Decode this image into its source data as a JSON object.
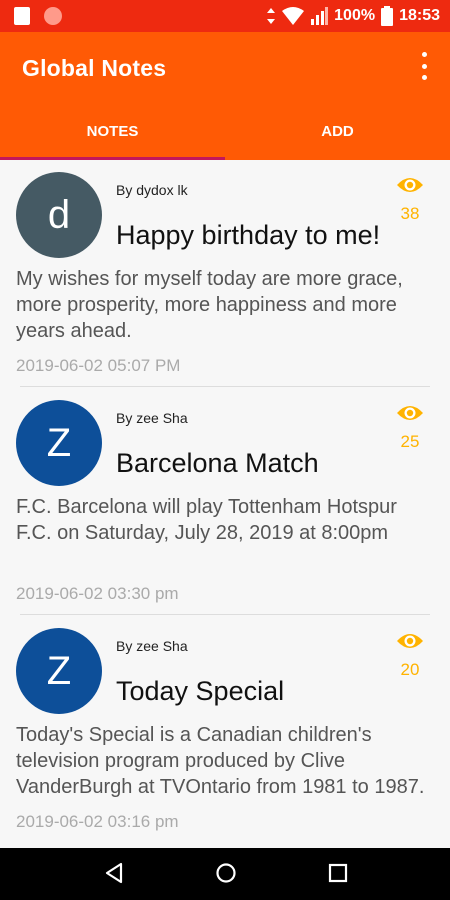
{
  "status_bar": {
    "battery": "100%",
    "time": "18:53"
  },
  "app": {
    "title": "Global Notes"
  },
  "tabs": [
    {
      "label": "NOTES",
      "selected": true
    },
    {
      "label": "ADD",
      "selected": false
    }
  ],
  "notes": [
    {
      "avatar_letter": "d",
      "avatar_color": "#455a64",
      "author": "By dydox lk",
      "title": "Happy birthday to me!",
      "views": "38",
      "body": "My wishes for myself today are more grace, more prosperity, more happiness and more years ahead.",
      "date": "2019-06-02 05:07 PM"
    },
    {
      "avatar_letter": "Z",
      "avatar_color": "#0d4f99",
      "author": "By zee Sha",
      "title": "Barcelona Match",
      "views": "25",
      "body": "F.C. Barcelona will play Tottenham Hotspur F.C. on Saturday, July 28, 2019 at 8:00pm",
      "date": "2019-06-02 03:30 pm"
    },
    {
      "avatar_letter": "Z",
      "avatar_color": "#0d4f99",
      "author": "By zee Sha",
      "title": "Today Special",
      "views": "20",
      "body": "Today's Special is a Canadian children's television program produced by Clive VanderBurgh at TVOntario from 1981 to 1987.",
      "date": "2019-06-02 03:16 pm"
    }
  ],
  "colors": {
    "status_bar": "#ee2a10",
    "app_bar": "#ff5a05",
    "tab_indicator": "#c2185b",
    "views_accent": "#ffb300"
  }
}
